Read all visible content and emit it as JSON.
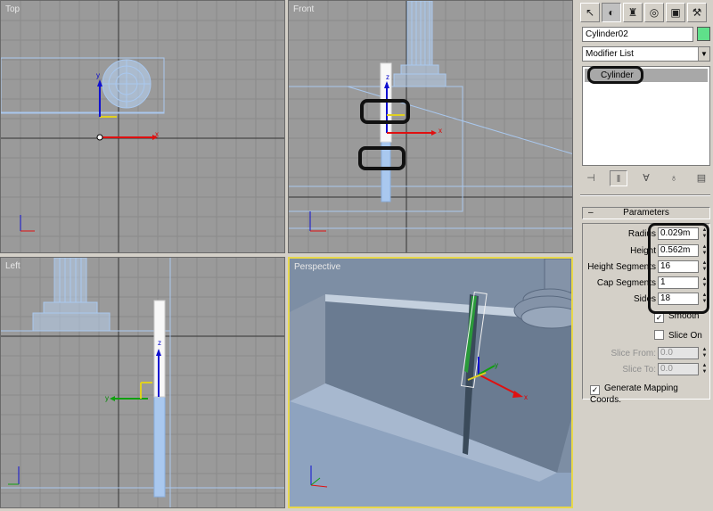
{
  "viewports": {
    "top": {
      "label": "Top"
    },
    "front": {
      "label": "Front"
    },
    "left": {
      "label": "Left"
    },
    "perspective": {
      "label": "Perspective"
    }
  },
  "axes": {
    "x": "x",
    "y": "y",
    "z": "z"
  },
  "panel": {
    "tabs": [
      "create-icon",
      "modify-icon",
      "hierarchy-icon",
      "motion-icon",
      "display-icon",
      "utilities-icon"
    ],
    "object_name": "Cylinder02",
    "object_color": "#5fe08a",
    "modifier_list": "Modifier List",
    "stack_item": "Cylinder",
    "rollout_title": "Parameters",
    "params": [
      {
        "label": "Radius",
        "value": "0.029m"
      },
      {
        "label": "Height",
        "value": "0.562m"
      },
      {
        "label": "Height Segments",
        "value": "16"
      },
      {
        "label": "Cap Segments",
        "value": "1"
      },
      {
        "label": "Sides",
        "value": "18"
      }
    ],
    "smooth_label": "Smooth",
    "slice_on_label": "Slice On",
    "slice_from_label": "Slice From:",
    "slice_from_value": "0.0",
    "slice_to_label": "Slice To:",
    "slice_to_value": "0.0",
    "gen_mapping_label": "Generate Mapping Coords."
  },
  "colors": {
    "viewport_bg": "#9a9a9a",
    "grid": "#8a8a8a",
    "wire": "#a9c8ef",
    "active_viewport_border": "#e8d84a",
    "highlight": "#111111"
  }
}
